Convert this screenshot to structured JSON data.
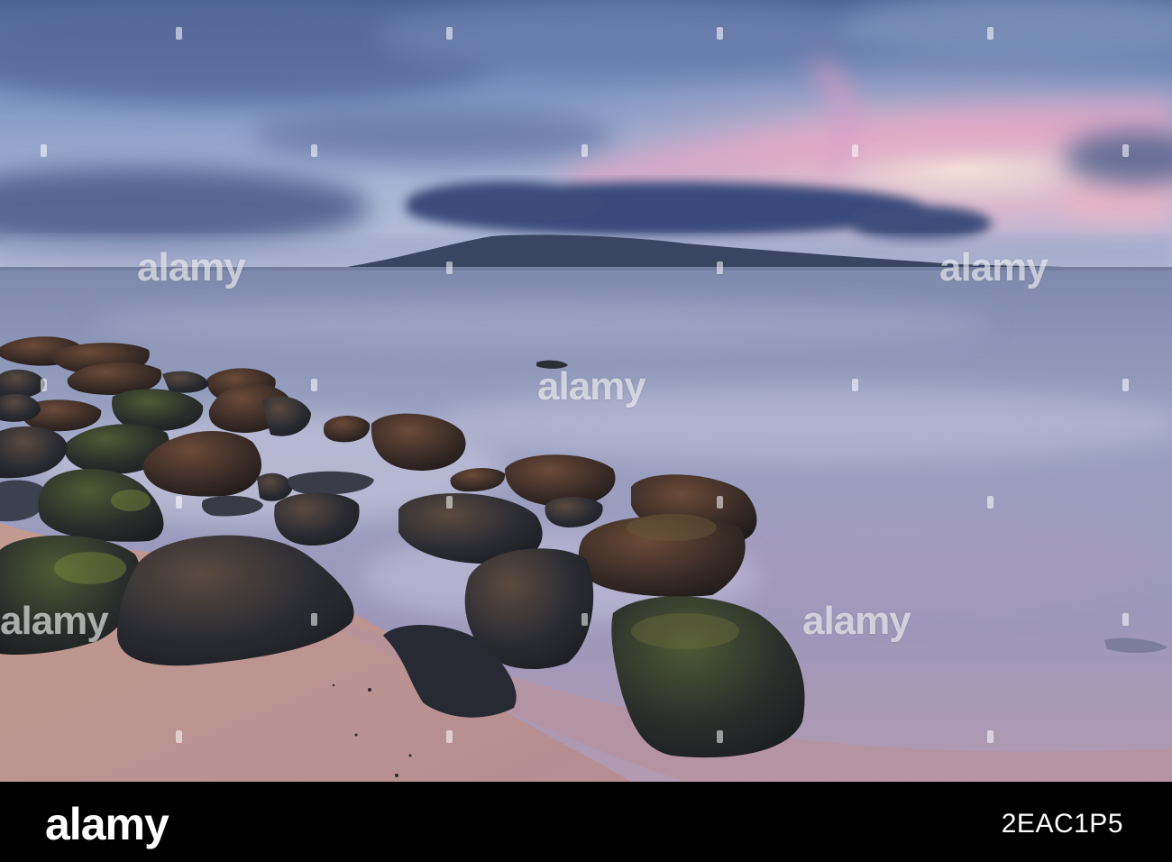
{
  "image": {
    "description_colors": {
      "sky_top": "#4a5f8f",
      "sky_mid": "#8aa0c6",
      "sunset_pink": "#e6a3c0",
      "sunset_glow": "#f3e1d6",
      "storm_cloud": "#3c4e78",
      "island": "#3a4663",
      "sea": "#8e95b8",
      "sand": "#c8998f",
      "rock": "#2e3038"
    }
  },
  "watermark": {
    "text": "alamy"
  },
  "footer": {
    "brand": "alamy",
    "image_id": "2EAC1P5"
  }
}
